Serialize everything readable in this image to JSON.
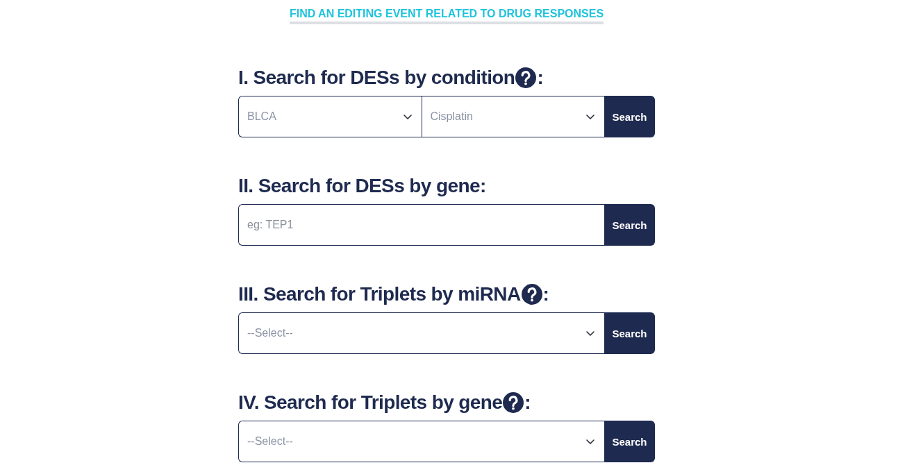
{
  "header": {
    "title": "FIND AN EDITING EVENT RELATED TO DRUG RESPONSES"
  },
  "sections": [
    {
      "title": "I. Search for DESs by condition",
      "help_icon": true,
      "title_end": ":",
      "controls": [
        {
          "kind": "dropdown",
          "value": "BLCA"
        },
        {
          "kind": "dropdown",
          "value": "Cisplatin"
        }
      ],
      "button": "Search"
    },
    {
      "title": "II. Search for DESs by gene",
      "help_icon": false,
      "title_end": ":",
      "controls": [
        {
          "kind": "text_input",
          "placeholder": "eg: TEP1"
        }
      ],
      "button": "Search"
    },
    {
      "title": "III. Search for Triplets by miRNA",
      "help_icon": true,
      "title_end": ":",
      "controls": [
        {
          "kind": "dropdown",
          "placeholder": "--Select--"
        }
      ],
      "button": "Search"
    },
    {
      "title": "IV. Search for Triplets by gene",
      "help_icon": true,
      "title_end": ":",
      "controls": [
        {
          "kind": "dropdown",
          "placeholder": "--Select--"
        }
      ],
      "button": "Search"
    }
  ]
}
